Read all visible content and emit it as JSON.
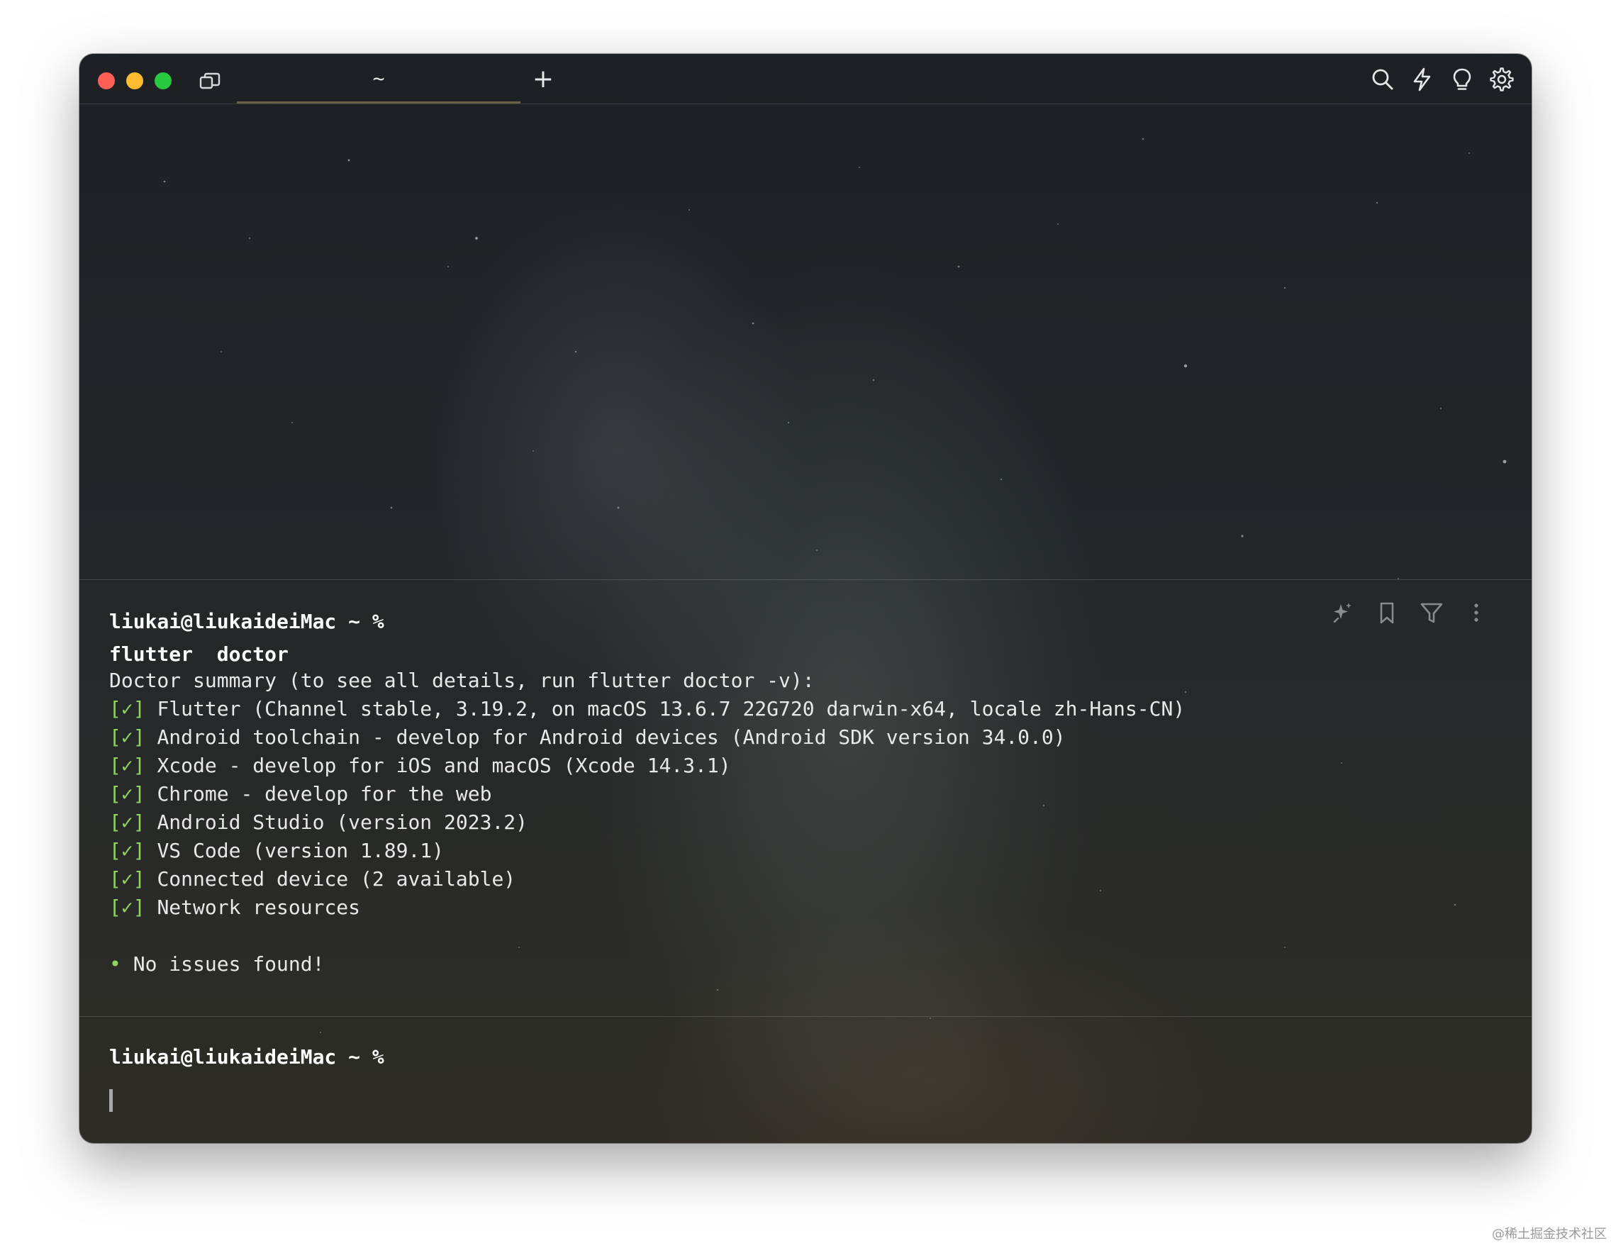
{
  "window": {
    "tab_title": "~",
    "new_tab_label": "+"
  },
  "toolbar_icons": [
    "search-icon",
    "bolt-icon",
    "lightbulb-icon",
    "gear-icon"
  ],
  "block_actions": [
    "sparkle-icon",
    "bookmark-icon",
    "filter-icon",
    "more-vertical-icon"
  ],
  "blocks": [
    {
      "prompt": "liukai@liukaideiMac ~ %",
      "command": "flutter  doctor",
      "output": {
        "summary": "Doctor summary (to see all details, run flutter doctor -v):",
        "checks": [
          {
            "mark": "[✓]",
            "text": "Flutter (Channel stable, 3.19.2, on macOS 13.6.7 22G720 darwin-x64, locale zh-Hans-CN)"
          },
          {
            "mark": "[✓]",
            "text": "Android toolchain - develop for Android devices (Android SDK version 34.0.0)"
          },
          {
            "mark": "[✓]",
            "text": "Xcode - develop for iOS and macOS (Xcode 14.3.1)"
          },
          {
            "mark": "[✓]",
            "text": "Chrome - develop for the web"
          },
          {
            "mark": "[✓]",
            "text": "Android Studio (version 2023.2)"
          },
          {
            "mark": "[✓]",
            "text": "VS Code (version 1.89.1)"
          },
          {
            "mark": "[✓]",
            "text": "Connected device (2 available)"
          },
          {
            "mark": "[✓]",
            "text": "Network resources"
          }
        ],
        "bullet": "•",
        "result": "No issues found!"
      }
    }
  ],
  "current_prompt": "liukai@liukaideiMac ~ %",
  "watermark": "@稀土掘金技术社区",
  "colors": {
    "check_green": "#8fd45c",
    "close": "#fe5f57",
    "minimize": "#febc2e",
    "maximize": "#28c840"
  }
}
